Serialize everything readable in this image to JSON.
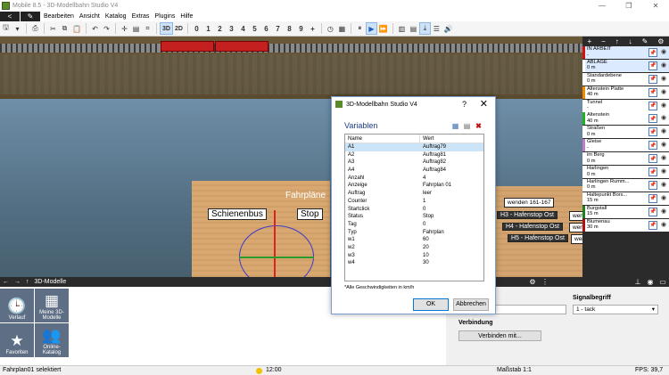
{
  "window": {
    "title": "Mobile 8.5 - 3D-Modellbahn Studio V4",
    "minimize": "—",
    "restore": "❐",
    "close": "✕"
  },
  "menu": {
    "back": "<",
    "edit": "✎",
    "items": [
      "Bearbeiten",
      "Ansicht",
      "Katalog",
      "Extras",
      "Plugins",
      "Hilfe"
    ]
  },
  "toolbar": {
    "view_3d": "3D",
    "view_2d": "2D",
    "numbers": [
      "0",
      "1",
      "2",
      "3",
      "4",
      "5",
      "6",
      "7",
      "8",
      "9"
    ],
    "plus": "+"
  },
  "scene": {
    "fahrplan_label": "Fahrpläne",
    "schienenbus": "Schienenbus",
    "stop": "Stop",
    "signs_right": [
      "wenden 161-167",
      "H3 - Hafenstop Ost",
      "H4 - Hafenstop Ost",
      "H5 - Hafenstop Ost"
    ],
    "sign_small": [
      "wende",
      "wende",
      "wende"
    ]
  },
  "viewport_bar": {
    "label": "3D-Modelle"
  },
  "tiles": [
    {
      "icon": "🕒",
      "label": "Verlauf"
    },
    {
      "icon": "▦",
      "label": "Meine 3D-Modelle"
    },
    {
      "icon": "★",
      "label": "Favoriten"
    },
    {
      "icon": "👥",
      "label": "Online-Katalog"
    }
  ],
  "props": {
    "signal_label": "Signalbegriff",
    "signal_value": "1 - tack",
    "connection_label": "Verbindung",
    "connect_button": "Verbinden mit..."
  },
  "status": {
    "selection": "Fahrplan01 selektiert",
    "time": "12:00",
    "scale": "Maßstab 1:1",
    "fps": "FPS: 39,7"
  },
  "layers": [
    {
      "name": "IN ARBEIT",
      "value": "-",
      "color": "#d51010",
      "active": true
    },
    {
      "name": "ABLAGE",
      "value": "0 m",
      "color": "#ffffff",
      "active": true
    },
    {
      "name": "Standardebene",
      "value": "0 m",
      "color": "#ffffff"
    },
    {
      "name": "Altenstein Platte",
      "value": "40 m",
      "color": "#f08a00"
    },
    {
      "name": "Tunnel",
      "value": "-",
      "color": "#ffffff"
    },
    {
      "name": "Altenstein",
      "value": "40 m",
      "color": "#20b020"
    },
    {
      "name": "Straßen",
      "value": "0 m",
      "color": "#ffffff"
    },
    {
      "name": "Gleise",
      "value": "-",
      "color": "#c080c0"
    },
    {
      "name": "im Berg",
      "value": "0 m",
      "color": "#ffffff"
    },
    {
      "name": "Harlingen",
      "value": "0 m",
      "color": "#ffffff"
    },
    {
      "name": "Harlingen Rumm...",
      "value": "0 m",
      "color": "#ffffff"
    },
    {
      "name": "Haltepunkt Bors...",
      "value": "15 m",
      "color": "#ffffff"
    },
    {
      "name": "Burgstall",
      "value": "15 m",
      "color": "#208020"
    },
    {
      "name": "Blumenau",
      "value": "30 m",
      "color": "#b01010"
    }
  ],
  "dialog": {
    "title": "3D-Modellbahn Studio V4",
    "help": "?",
    "close": "✕",
    "heading": "Variablen",
    "col_name": "Name",
    "col_value": "Wert",
    "rows": [
      [
        "A1",
        "Auftrag79"
      ],
      [
        "A2",
        "Auftrag81"
      ],
      [
        "A3",
        "Auftrag82"
      ],
      [
        "A4",
        "Auftrag84"
      ],
      [
        "Anzahl",
        "4"
      ],
      [
        "Anzeige",
        "Fahrplan 01"
      ],
      [
        "Auftrag",
        "leer"
      ],
      [
        "Counter",
        "1"
      ],
      [
        "Startclick",
        "0"
      ],
      [
        "Status",
        "Stop"
      ],
      [
        "Tag",
        "0"
      ],
      [
        "Typ",
        "Fahrplan"
      ],
      [
        "w1",
        "60"
      ],
      [
        "w2",
        "20"
      ],
      [
        "w3",
        "10"
      ],
      [
        "w4",
        "30"
      ]
    ],
    "note": "*Alle Geschwindigkeiten in km/h",
    "ok": "OK",
    "cancel": "Abbrechen"
  }
}
